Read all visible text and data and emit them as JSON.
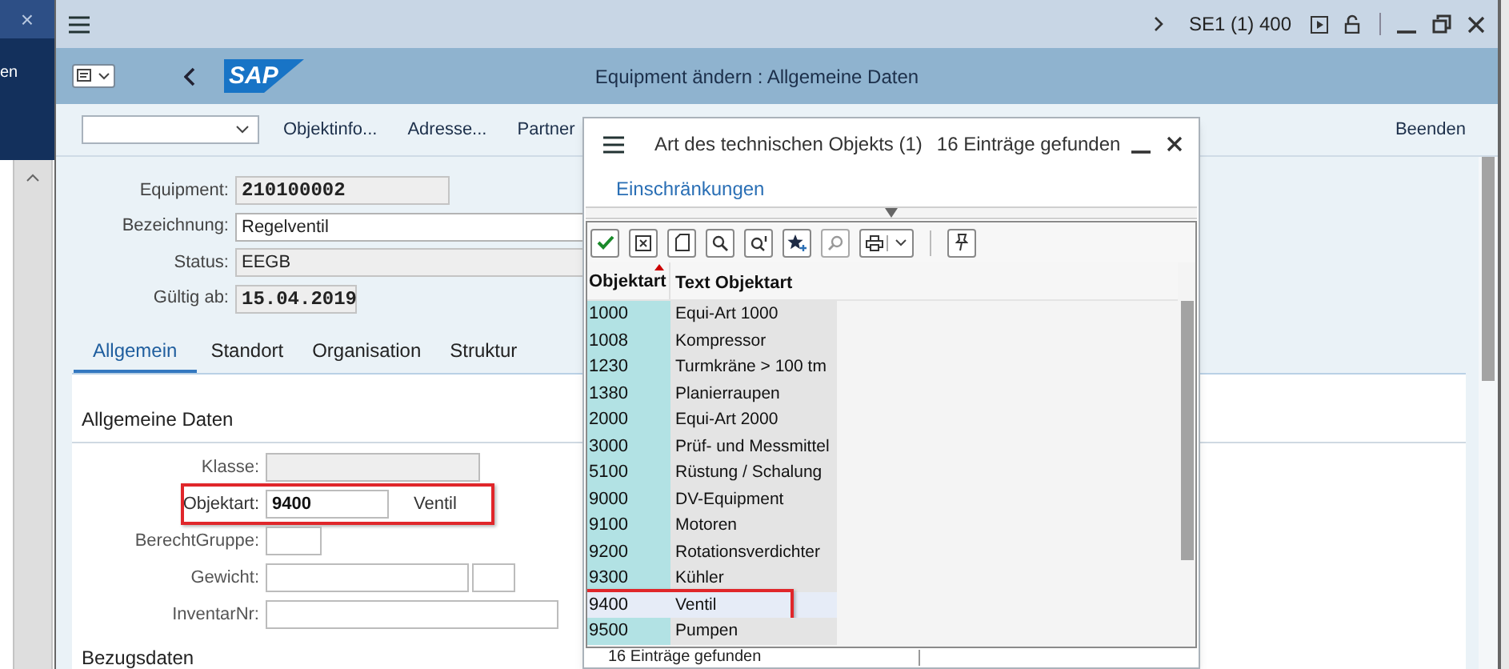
{
  "sidebar": {
    "close": "×",
    "text": "en"
  },
  "top_bar": {
    "system": "SE1 (1) 400"
  },
  "header": {
    "logo": "SAP",
    "title": "Equipment ändern : Allgemeine Daten"
  },
  "toolbar": {
    "buttons": [
      "Objektinfo...",
      "Adresse...",
      "Partner"
    ],
    "exit": "Beenden"
  },
  "header_fields": [
    {
      "label": "Equipment:",
      "value": "210100002",
      "kind": "readonly"
    },
    {
      "label": "Bezeichnung:",
      "value": "Regelventil",
      "kind": "input"
    },
    {
      "label": "Status:",
      "value": "EEGB",
      "kind": "readonly"
    },
    {
      "label": "Gültig ab:",
      "value": "15.04.2019",
      "kind": "readonly"
    }
  ],
  "tabs": [
    {
      "label": "Allgemein",
      "selected": true
    },
    {
      "label": "Standort",
      "selected": false
    },
    {
      "label": "Organisation",
      "selected": false
    },
    {
      "label": "Struktur",
      "selected": false
    }
  ],
  "section": {
    "title": "Allgemeine Daten",
    "fields": [
      {
        "label": "Klasse:",
        "kind": "readonly",
        "highlighted": false
      },
      {
        "label": "Objektart:",
        "kind": "code",
        "value": "9400",
        "description": "Ventil",
        "highlighted": true
      },
      {
        "label": "BerechtGruppe:",
        "kind": "short",
        "highlighted": false
      },
      {
        "label": "Gewicht:",
        "kind": "pair",
        "highlighted": false
      },
      {
        "label": "InventarNr:",
        "kind": "input",
        "highlighted": false
      }
    ]
  },
  "next_section": "Bezugsdaten",
  "popup": {
    "title": "Art des technischen Objekts (1)",
    "count": "16 Einträge gefunden",
    "link": "Einschränkungen",
    "columns": [
      "Objektart",
      "Text Objektart"
    ],
    "rows": [
      {
        "code": "1000",
        "text": "Equi-Art 1000",
        "selected": false,
        "highlighted": false
      },
      {
        "code": "1008",
        "text": "Kompressor",
        "selected": false,
        "highlighted": false
      },
      {
        "code": "1230",
        "text": "Turmkräne > 100 tm",
        "selected": false,
        "highlighted": false
      },
      {
        "code": "1380",
        "text": "Planierraupen",
        "selected": false,
        "highlighted": false
      },
      {
        "code": "2000",
        "text": "Equi-Art 2000",
        "selected": false,
        "highlighted": false
      },
      {
        "code": "3000",
        "text": "Prüf- und Messmittel",
        "selected": false,
        "highlighted": false
      },
      {
        "code": "5100",
        "text": "Rüstung / Schalung",
        "selected": false,
        "highlighted": false
      },
      {
        "code": "9000",
        "text": "DV-Equipment",
        "selected": false,
        "highlighted": false
      },
      {
        "code": "9100",
        "text": "Motoren",
        "selected": false,
        "highlighted": false
      },
      {
        "code": "9200",
        "text": "Rotationsverdichter",
        "selected": false,
        "highlighted": false
      },
      {
        "code": "9300",
        "text": "Kühler",
        "selected": false,
        "highlighted": false
      },
      {
        "code": "9400",
        "text": "Ventil",
        "selected": true,
        "highlighted": true
      },
      {
        "code": "9500",
        "text": "Pumpen",
        "selected": false,
        "highlighted": false
      }
    ],
    "status": "16 Einträge gefunden"
  }
}
